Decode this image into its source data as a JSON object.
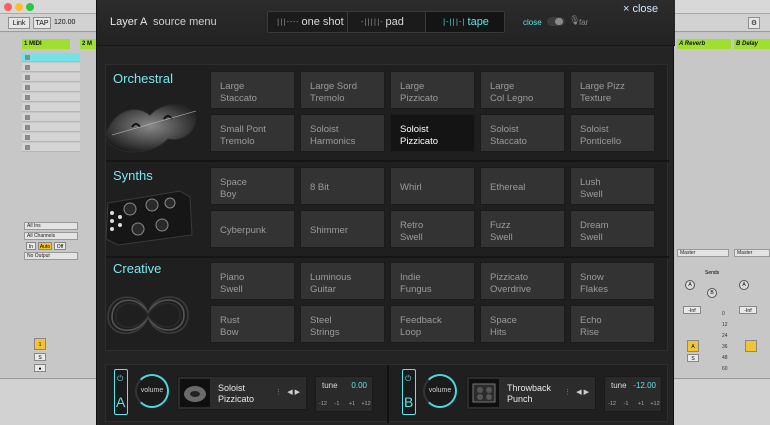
{
  "host": {
    "buttons": {
      "link": "Link",
      "tap": "TAP",
      "tempo": "120.00"
    },
    "left_track": {
      "head1": "1 MIDI",
      "head2": "2 M",
      "io": [
        "All Ins",
        "All Channels",
        "No Output"
      ],
      "monitor": [
        "In",
        "Auto",
        "Off"
      ],
      "track_number": "1",
      "solo": "S"
    },
    "right_panel": {
      "returns": [
        "A Reverb",
        "B Delay"
      ],
      "master_dropdowns": [
        "Master",
        "Master"
      ],
      "sends_label": "Sends",
      "send_knobs": [
        "A",
        "B"
      ],
      "volume": "-Inf",
      "meter_scale": [
        "0",
        "12",
        "24",
        "36",
        "48",
        "60"
      ],
      "track_letter": "A",
      "solo": "S"
    }
  },
  "plugin": {
    "layer": "Layer A",
    "source_menu": "source menu",
    "modes": [
      {
        "label": "one shot",
        "glyph": "|||----"
      },
      {
        "label": "pad",
        "glyph": "-|||||-"
      },
      {
        "label": "tape",
        "glyph": "|-|||-|"
      }
    ],
    "active_mode": "tape",
    "close_toggle_label": "close",
    "far_label": "far",
    "close_button": {
      "x": "×",
      "label": "close"
    },
    "accent_color": "#5fe4e8",
    "categories": [
      {
        "name": "Orchestral",
        "icon": "violin-icon",
        "tiles": [
          "Large\nStaccato",
          "Large Sord\nTremolo",
          "Large\nPizzicato",
          "Large\nCol Legno",
          "Large Pizz\nTexture",
          "Small Pont\nTremolo",
          "Soloist\nHarmonics",
          "Soloist\nPizzicato",
          "Soloist\nStaccato",
          "Soloist\nPonticello"
        ]
      },
      {
        "name": "Synths",
        "icon": "synth-module-icon",
        "tiles": [
          "Space\nBoy",
          "8 Bit",
          "Whirl",
          "Ethereal",
          "Lush\nSwell",
          "Cyberpunk",
          "Shimmer",
          "Retro\nSwell",
          "Fuzz\nSwell",
          "Dream\nSwell"
        ]
      },
      {
        "name": "Creative",
        "icon": "infinity-cable-icon",
        "tiles": [
          "Piano\nSwell",
          "Luminous\nGuitar",
          "Indie\nFungus",
          "Pizzicato\nOverdrive",
          "Snow\nFlakes",
          "Rust\nBow",
          "Steel\nStrings",
          "Feedback\nLoop",
          "Space\nHits",
          "Echo\nRise"
        ]
      }
    ],
    "selected_tile": "Soloist\nPizzicato",
    "footer": {
      "layers": [
        {
          "letter": "A",
          "volume": "volume",
          "preset": "Soloist\nPizzicato",
          "tune_label": "tune",
          "tune_value": "0.00",
          "steps": [
            "-12",
            "-1",
            "+1",
            "+12"
          ]
        },
        {
          "letter": "B",
          "volume": "volume",
          "preset": "Throwback\nPunch",
          "tune_label": "tune",
          "tune_value": "-12.00",
          "steps": [
            "-12",
            "-1",
            "+1",
            "+12"
          ]
        }
      ]
    }
  }
}
